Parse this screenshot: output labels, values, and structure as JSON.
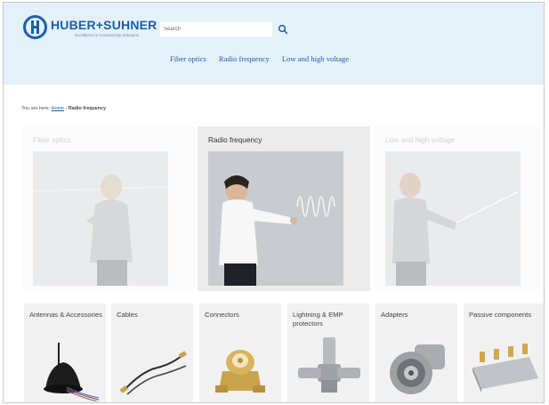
{
  "header": {
    "brand": "HUBER+SUHNER",
    "tagline": "Excellence in Connectivity Solutions",
    "search_placeholder": "Search",
    "nav": [
      {
        "label": "Fiber optics"
      },
      {
        "label": "Radio frequency"
      },
      {
        "label": "Low and high voltage"
      }
    ]
  },
  "breadcrumb": {
    "prefix": "You are here:",
    "home": "Home",
    "separator": "›",
    "current": "Radio frequency"
  },
  "categories": [
    {
      "label": "Fiber optics",
      "state": "faded"
    },
    {
      "label": "Radio frequency",
      "state": "active"
    },
    {
      "label": "Low and high voltage",
      "state": "faded"
    }
  ],
  "products": [
    {
      "label": "Antennas & Accessories",
      "icon": "antenna-icon"
    },
    {
      "label": "Cables",
      "icon": "cable-icon"
    },
    {
      "label": "Connectors",
      "icon": "connector-icon"
    },
    {
      "label": "Lightning & EMP protectors",
      "icon": "protector-icon"
    },
    {
      "label": "Adapters",
      "icon": "adapter-icon"
    },
    {
      "label": "Passive components",
      "icon": "passive-component-icon"
    }
  ],
  "colors": {
    "brand": "#1f5ea8",
    "header_bg": "#e4f1f9",
    "tile_bg": "#f1f1f1"
  }
}
